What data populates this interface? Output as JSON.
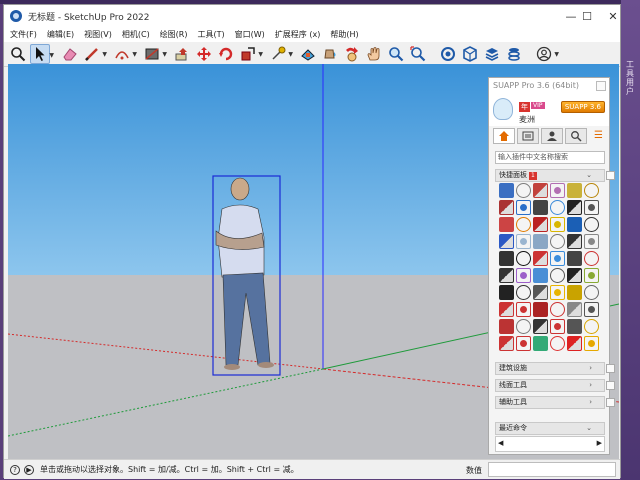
{
  "window": {
    "title": "无标题 - SketchUp Pro 2022",
    "minimize": "—",
    "maximize": "☐",
    "close": "✕"
  },
  "menu": [
    {
      "label": "文件(F)"
    },
    {
      "label": "编辑(E)"
    },
    {
      "label": "视图(V)"
    },
    {
      "label": "相机(C)"
    },
    {
      "label": "绘图(R)"
    },
    {
      "label": "工具(T)"
    },
    {
      "label": "窗口(W)"
    },
    {
      "label": "扩展程序 (x)"
    },
    {
      "label": "帮助(H)"
    }
  ],
  "toolbar": {
    "icons": [
      "search-icon",
      "select-arrow-icon",
      "eraser-icon",
      "pencil-line-icon",
      "arc-icon",
      "rectangle-icon",
      "push-pull-icon",
      "move-icon",
      "rotate-icon",
      "scale-icon",
      "tape-measure-icon",
      "section-plane-icon",
      "paint-bucket-icon",
      "orbit-icon",
      "pan-icon",
      "zoom-icon",
      "zoom-extents-icon",
      "warehouse-icon",
      "extension-icon",
      "layers-icon",
      "account-icon"
    ]
  },
  "panel": {
    "title": "SUAPP Pro 3.6 (64bit)",
    "year_badge": "年",
    "vip_badge": "VIP",
    "user_name": "麦洲",
    "version_badge": "SUAPP 3.6",
    "tabs": [
      "home-icon",
      "list-icon",
      "user-icon",
      "search-icon"
    ],
    "search_placeholder": "输入插件中文名称搜索",
    "quick_panel_label": "快捷面板",
    "quick_panel_count": "1",
    "sections": [
      {
        "label": "建筑设施",
        "arrow": "›"
      },
      {
        "label": "线面工具",
        "arrow": "›"
      },
      {
        "label": "辅助工具",
        "arrow": "›"
      },
      {
        "label": "最近命令",
        "arrow": "⌄"
      }
    ],
    "icon_colors": [
      "#3b6fc2",
      "#7d7d7d",
      "#c2423c",
      "#b26fb2",
      "#c9b23a",
      "#b8860b",
      "#a33",
      "#2a6fc9",
      "#444",
      "#3b8ad9",
      "#222",
      "#555",
      "#c44",
      "#e07b00",
      "#b22",
      "#d9b600",
      "#1b5fb5",
      "#333",
      "#2b58c4",
      "#9ab5d0",
      "#8aa7c5",
      "#777",
      "#333",
      "#888",
      "#333",
      "#111",
      "#c33",
      "#3c8ddc",
      "#444",
      "#c33",
      "#333",
      "#9c5fc9",
      "#4a8fd6",
      "#555",
      "#222",
      "#8a3",
      "#222",
      "#333",
      "#555",
      "#e8b400",
      "#c9a300",
      "#666",
      "#c33",
      "#c33",
      "#a22",
      "#c33",
      "#888",
      "#555",
      "#b33",
      "#777",
      "#333",
      "#c33",
      "#555",
      "#d6a400",
      "#c33",
      "#c33",
      "#3a7",
      "#d33",
      "#d22",
      "#e6a800"
    ],
    "scroll_left": "◀",
    "scroll_right": "▶"
  },
  "status": {
    "text": "单击或拖动以选择对象。Shift = 加/减。Ctrl = 加。Shift + Ctrl = 减。",
    "measure_label": "数值"
  },
  "desktop_right": {
    "text": "工具 用户"
  }
}
